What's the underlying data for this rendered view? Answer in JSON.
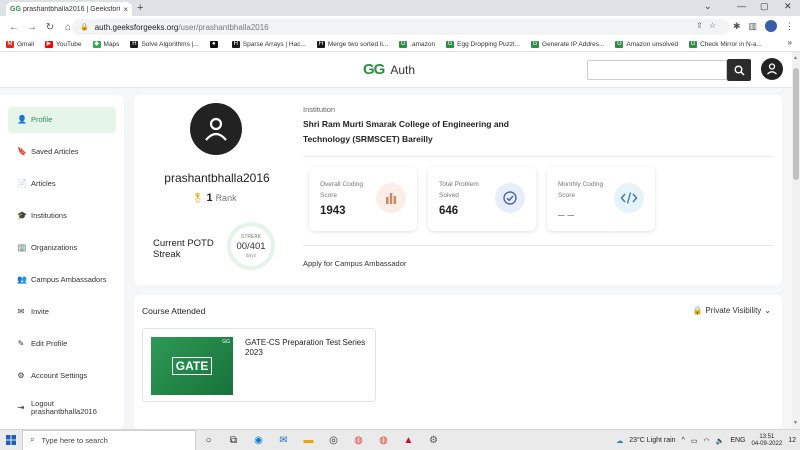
{
  "browser": {
    "tab_title": "prashantbhalla2016 | GeeksforGe",
    "tab_close": "×",
    "new_tab": "+",
    "url_host": "auth.geeksforgeeks.org",
    "url_path": "/user/prashantbhalla2016",
    "window_min": "⌄",
    "window_controls": [
      "—",
      "▢",
      "✕"
    ],
    "bookmarks": [
      {
        "label": "Gmail",
        "color": "#d93025",
        "glyph": "M"
      },
      {
        "label": "YouTube",
        "color": "#ff0000",
        "glyph": "▶"
      },
      {
        "label": "Maps",
        "color": "#34a853",
        "glyph": "◆"
      },
      {
        "label": "Solve Algorithms |...",
        "color": "#1b1b1b",
        "glyph": "H"
      },
      {
        "label": "",
        "color": "#111111",
        "glyph": "●"
      },
      {
        "label": "Sparse Arrays | Hac...",
        "color": "#1b1b1b",
        "glyph": "H"
      },
      {
        "label": "Merge two sorted li...",
        "color": "#1b1b1b",
        "glyph": "H"
      },
      {
        "label": ".amazon",
        "color": "#2f8d46",
        "glyph": "G"
      },
      {
        "label": "Egg Dropping Puzzl...",
        "color": "#2f8d46",
        "glyph": "G"
      },
      {
        "label": "Generate IP Addres...",
        "color": "#2f8d46",
        "glyph": "G"
      },
      {
        "label": "Amazon unsolved",
        "color": "#2f8d46",
        "glyph": "G"
      },
      {
        "label": "Check Mirror in N-a...",
        "color": "#2f8d46",
        "glyph": "G"
      }
    ],
    "bookmarks_more": "»"
  },
  "header": {
    "logo_mark": "GG",
    "logo_text": "Auth"
  },
  "sidebar": {
    "items": [
      {
        "label": "Profile",
        "icon": "👤",
        "active": true
      },
      {
        "label": "Saved Articles",
        "icon": "🔖"
      },
      {
        "label": "Articles",
        "icon": "📄"
      },
      {
        "label": "Institutions",
        "icon": "🎓"
      },
      {
        "label": "Organizations",
        "icon": "🏢"
      },
      {
        "label": "Campus Ambassadors",
        "icon": "👥"
      },
      {
        "label": "Invite",
        "icon": "✉"
      },
      {
        "label": "Edit Profile",
        "icon": "✎"
      },
      {
        "label": "Account Settings",
        "icon": "⚙"
      },
      {
        "label": "Logout prashantbhalla2016",
        "icon": "⇥"
      }
    ]
  },
  "profile": {
    "username": "prashantbhalla2016",
    "rank_value": "1",
    "rank_label": "Rank",
    "potd_label": "Current POTD Streak",
    "streak_caption": "STREAK",
    "streak_value": "00/401",
    "streak_unit": "days",
    "institution_label": "Institution",
    "institution_name": "Shri Ram Murti Smarak College of Engineering and Technology (SRMSCET) Bareilly",
    "stats": [
      {
        "label": "Overall Coding Score",
        "value": "1943",
        "icon": "bar-chart-icon",
        "icon_bg": "#fbeee6",
        "icon_color": "#c98a6a"
      },
      {
        "label": "Total Problem Solved",
        "value": "646",
        "icon": "check-circle-icon",
        "icon_bg": "#e8eef9",
        "icon_color": "#4b66a8"
      },
      {
        "label": "Monthly Coding Score",
        "value": "_ _",
        "icon": "code-icon",
        "icon_bg": "#e7f3fa",
        "icon_color": "#3a7fb0"
      }
    ],
    "ambassador_link": "Apply for Campus Ambassador"
  },
  "courses": {
    "title": "Course Attended",
    "visibility": "Private Visibility",
    "items": [
      {
        "thumb_text": "GATE",
        "name": "GATE-CS Preparation Test Series 2023"
      }
    ]
  },
  "taskbar": {
    "search_placeholder": "Type here to search",
    "weather": "23°C  Light rain",
    "lang": "ENG",
    "time": "13:51",
    "date": "04-09-2022",
    "notif": "12"
  },
  "colors": {
    "brand_green": "#2f8d46",
    "active_bg": "#e6f5e9"
  }
}
